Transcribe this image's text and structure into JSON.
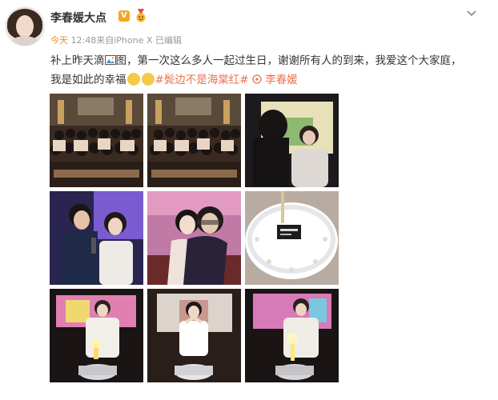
{
  "user": {
    "name": "李春媛大点",
    "verified_badge": "V"
  },
  "meta": {
    "today": "今天",
    "time": "12:48",
    "source": "来自iPhone X",
    "edited": "已编辑"
  },
  "post": {
    "text_1": "补上昨天滴",
    "text_2": "图，第一次这么多人一起过生日，谢谢所有人的到来，我爱这个大家庭，我是如此的幸福",
    "hashtag": "#鬓边不是海棠红#",
    "mention": "李春媛"
  },
  "icons": {
    "chevron": "chevron-down-icon",
    "medal": "medal-icon",
    "photo": "photo-icon",
    "emoji": "smiling-face-icon",
    "mention": "mention-icon"
  },
  "colors": {
    "link": "#eb7350",
    "verified": "#f5a623",
    "meta": "#999999",
    "today": "#f28c28"
  }
}
